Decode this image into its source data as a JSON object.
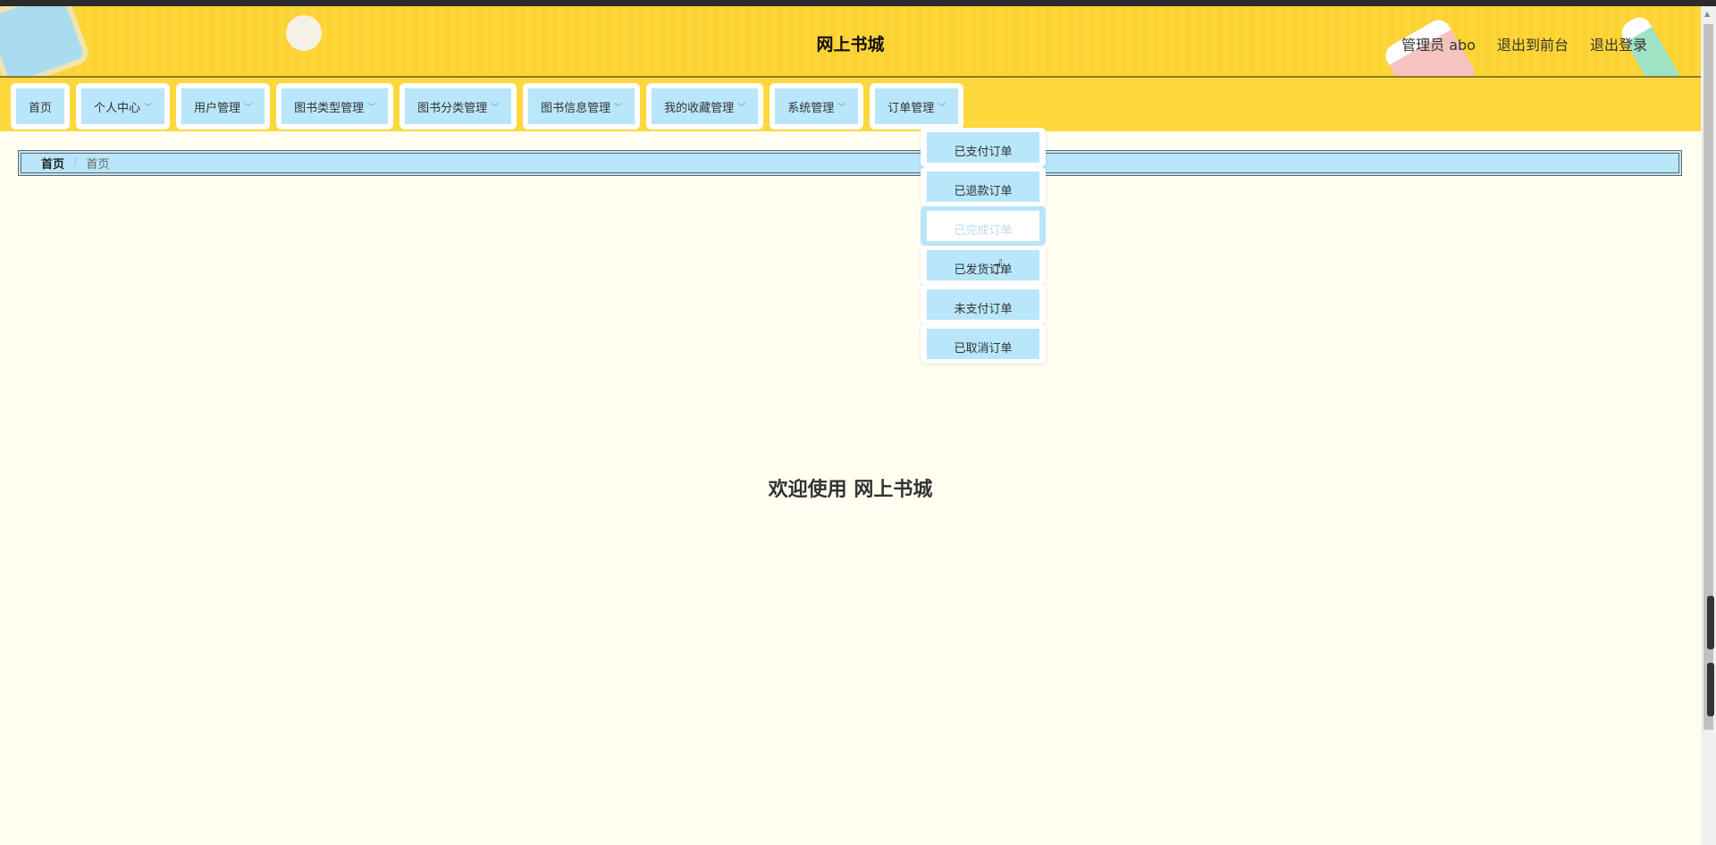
{
  "header": {
    "title": "网上书城",
    "user": "管理员 abo",
    "to_front": "退出到前台",
    "logout": "退出登录"
  },
  "nav": [
    {
      "label": "首页",
      "dropdown": false
    },
    {
      "label": "个人中心",
      "dropdown": true
    },
    {
      "label": "用户管理",
      "dropdown": true
    },
    {
      "label": "图书类型管理",
      "dropdown": true
    },
    {
      "label": "图书分类管理",
      "dropdown": true
    },
    {
      "label": "图书信息管理",
      "dropdown": true
    },
    {
      "label": "我的收藏管理",
      "dropdown": true
    },
    {
      "label": "系统管理",
      "dropdown": true
    },
    {
      "label": "订单管理",
      "dropdown": true
    }
  ],
  "order_menu": [
    "已支付订单",
    "已退款订单",
    "已完成订单",
    "已发货订单",
    "未支付订单",
    "已取消订单"
  ],
  "breadcrumb": {
    "home": "首页",
    "current": "首页"
  },
  "welcome": "欢迎使用 网上书城",
  "colors": {
    "header": "#fdd83c",
    "item": "#b9e6fb",
    "bg": "#fffef0"
  }
}
